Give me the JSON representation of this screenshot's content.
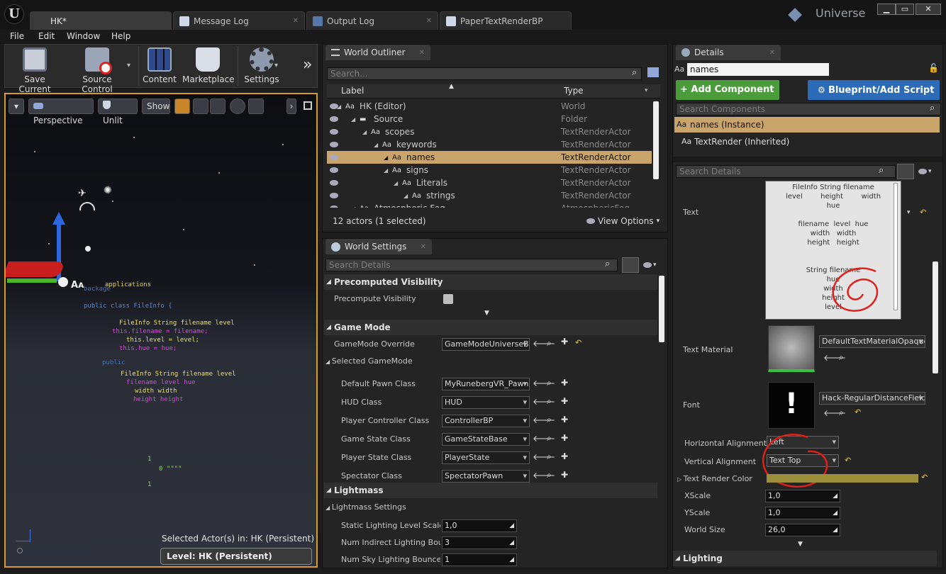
{
  "window": {
    "tabs": [
      "HK*",
      "Message Log",
      "Output Log",
      "PaperTextRenderBP"
    ],
    "project": "Universe",
    "minimize": "▁",
    "maximize": "▭",
    "close": "✕"
  },
  "menu": [
    "File",
    "Edit",
    "Window",
    "Help"
  ],
  "toolbar": {
    "save": "Save Current",
    "source": "Source Control",
    "content": "Content",
    "marketplace": "Marketplace",
    "settings": "Settings"
  },
  "viewport": {
    "perspective": "Perspective",
    "unlit": "Unlit",
    "show": "Show",
    "selected_actors": "Selected Actor(s) in:  HK (Persistent)",
    "level": "Level:  HK (Persistent)",
    "code_lines": [
      {
        "t": "applications",
        "c": "#e8d23a"
      },
      {
        "t": "backage",
        "c": "#3f6fd0"
      },
      {
        "t": "public class FileInfo {",
        "c": "#4a8ae0"
      },
      {
        "t": "FileInfo String filename      level",
        "c": "#f0e040"
      },
      {
        "t": "this.filename = filename;",
        "c": "#e040e0"
      },
      {
        "t": "this.level = level;",
        "c": "#e0e050"
      },
      {
        "t": "this.hue = hue;",
        "c": "#e040e0"
      },
      {
        "t": "public",
        "c": "#3f6fd0"
      },
      {
        "t": "FileInfo String filename     level",
        "c": "#f0e040"
      },
      {
        "t": "filename  level  hue",
        "c": "#e040e0"
      },
      {
        "t": "width  width",
        "c": "#e0e050"
      },
      {
        "t": "height  height",
        "c": "#e040e0"
      },
      {
        "t": "1",
        "c": "#80e060"
      },
      {
        "t": "0  \"\"\"\"",
        "c": "#80e060"
      },
      {
        "t": "1",
        "c": "#80e060"
      }
    ]
  },
  "outliner": {
    "tab": "World Outliner",
    "search_placeholder": "Search...",
    "col_label": "Label",
    "col_type": "Type",
    "rows": [
      {
        "label": "HK (Editor)",
        "type": "World"
      },
      {
        "label": "Source",
        "type": "Folder"
      },
      {
        "label": "scopes",
        "type": "TextRenderActor"
      },
      {
        "label": "keywords",
        "type": "TextRenderActor"
      },
      {
        "label": "names",
        "type": "TextRenderActor"
      },
      {
        "label": "signs",
        "type": "TextRenderActor"
      },
      {
        "label": "Literals",
        "type": "TextRenderActor"
      },
      {
        "label": "strings",
        "type": "TextRenderActor"
      },
      {
        "label": "Atmospheric Fog",
        "type": "AtmosphericFog"
      }
    ],
    "count": "12 actors (1 selected)",
    "view_options": "View Options"
  },
  "world_settings": {
    "tab": "World Settings",
    "search_placeholder": "Search Details",
    "sec_precomputed": "Precomputed Visibility",
    "precompute_visibility": "Precompute Visibility",
    "sec_game_mode": "Game Mode",
    "gamemode_override": "GameMode Override",
    "gamemode_override_val": "GameModeUniverseB",
    "selected_gamemode": "Selected GameMode",
    "props": [
      {
        "label": "Default Pawn Class",
        "value": "MyRunebergVR_Pawn"
      },
      {
        "label": "HUD Class",
        "value": "HUD"
      },
      {
        "label": "Player Controller Class",
        "value": "ControllerBP"
      },
      {
        "label": "Game State Class",
        "value": "GameStateBase"
      },
      {
        "label": "Player State Class",
        "value": "PlayerState"
      },
      {
        "label": "Spectator Class",
        "value": "SpectatorPawn"
      }
    ],
    "sec_lightmass": "Lightmass",
    "lightmass_settings": "Lightmass Settings",
    "lm_props": [
      {
        "label": "Static Lighting Level Scale",
        "value": "1,0"
      },
      {
        "label": "Num Indirect Lighting Bounces",
        "value": "3"
      },
      {
        "label": "Num Sky Lighting Bounces",
        "value": "1"
      }
    ]
  },
  "details": {
    "tab": "Details",
    "name_value": "names",
    "add_component": "+ Add Component",
    "blueprint_script": "Blueprint/Add Script",
    "search_components": "Search Components",
    "instance": "names (Instance)",
    "inherited": "TextRender (Inherited)",
    "search_details": "Search Details",
    "text_label": "Text",
    "text_lines": [
      "FileInfo String filename",
      "level        height        width",
      "hue",
      "",
      "filename  level  hue",
      "width   width",
      "height   height",
      "",
      "",
      "String filename",
      "hue",
      "width",
      "height",
      "level"
    ],
    "text_material_label": "Text Material",
    "text_material_value": "DefaultTextMaterialOpaque",
    "font_label": "Font",
    "font_value": "Hack-RegularDistanceField",
    "h_align_label": "Horizontal Alignment",
    "h_align_value": "Left",
    "v_align_label": "Vertical Alignment",
    "v_align_value": "Text Top",
    "color_label": "Text Render Color",
    "xscale_label": "XScale",
    "xscale_value": "1,0",
    "yscale_label": "YScale",
    "yscale_value": "1,0",
    "worldsize_label": "World Size",
    "worldsize_value": "26,0",
    "sec_lighting": "Lighting"
  },
  "colors": {
    "accent_orange": "#d69b2a",
    "selected_row": "#c9a56c",
    "add_component_green": "#4b9c3a",
    "blueprint_blue": "#2c6bb8",
    "text_render_color": "#9b8f3c",
    "annotation_red": "#e0201a"
  }
}
